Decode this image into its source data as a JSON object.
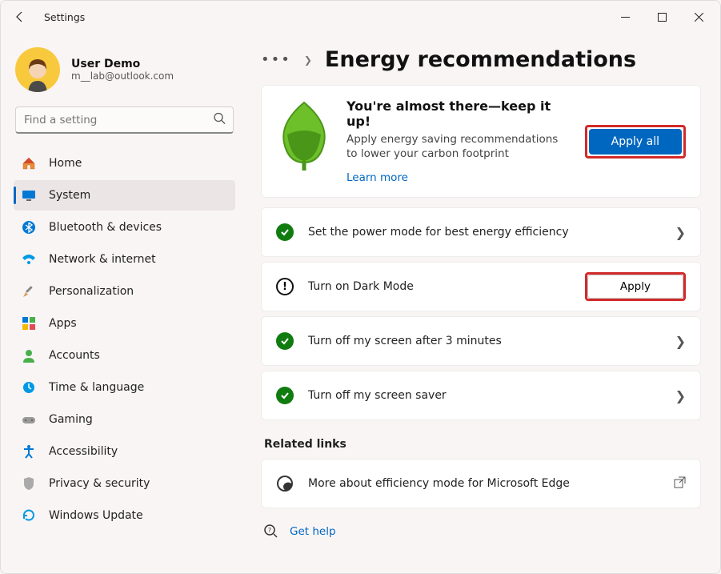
{
  "app_title": "Settings",
  "profile": {
    "name": "User Demo",
    "email": "m__lab@outlook.com"
  },
  "search": {
    "placeholder": "Find a setting"
  },
  "nav": {
    "items": [
      {
        "label": "Home"
      },
      {
        "label": "System"
      },
      {
        "label": "Bluetooth & devices"
      },
      {
        "label": "Network & internet"
      },
      {
        "label": "Personalization"
      },
      {
        "label": "Apps"
      },
      {
        "label": "Accounts"
      },
      {
        "label": "Time & language"
      },
      {
        "label": "Gaming"
      },
      {
        "label": "Accessibility"
      },
      {
        "label": "Privacy & security"
      },
      {
        "label": "Windows Update"
      }
    ]
  },
  "page": {
    "title": "Energy recommendations",
    "hero_title": "You're almost there—keep it up!",
    "hero_text": "Apply energy saving recommendations to lower your carbon footprint",
    "learn_more": "Learn more",
    "apply_all": "Apply all"
  },
  "recommendations": [
    {
      "label": "Set the power mode for best energy efficiency",
      "status": "done"
    },
    {
      "label": "Turn on Dark Mode",
      "status": "pending",
      "action": "Apply"
    },
    {
      "label": "Turn off my screen after 3 minutes",
      "status": "done"
    },
    {
      "label": "Turn off my screen saver",
      "status": "done"
    }
  ],
  "related": {
    "header": "Related links",
    "items": [
      {
        "label": "More about efficiency mode for Microsoft Edge"
      }
    ]
  },
  "help": {
    "label": "Get help"
  }
}
